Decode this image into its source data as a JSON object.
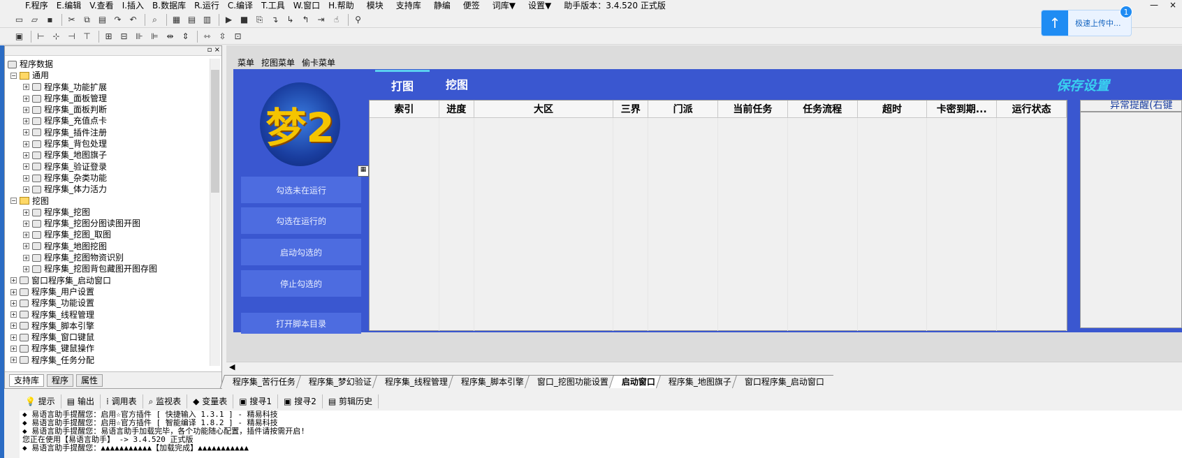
{
  "menubar": {
    "items": [
      "F.程序",
      "E.编辑",
      "V.查看",
      "I.插入",
      "B.数据库",
      "R.运行",
      "C.编译",
      "T.工具",
      "W.窗口",
      "H.帮助",
      "模块",
      "支持库",
      "静编",
      "便签",
      "词库▼",
      "设置▼",
      "助手版本：3.4.520 正式版"
    ],
    "window_min": "—",
    "window_close": "×"
  },
  "upload": {
    "label": "极速上传中...",
    "count": "1"
  },
  "left_panel": {
    "tree": [
      {
        "text": "程序数据",
        "depth": 0,
        "type": "root"
      },
      {
        "text": "通用",
        "depth": 0,
        "type": "folder",
        "expander": "−"
      },
      {
        "text": "程序集_功能扩展",
        "depth": 1,
        "type": "item",
        "expander": "+"
      },
      {
        "text": "程序集_面板管理",
        "depth": 1,
        "type": "item",
        "expander": "+"
      },
      {
        "text": "程序集_面板判断",
        "depth": 1,
        "type": "item",
        "expander": "+"
      },
      {
        "text": "程序集_充值点卡",
        "depth": 1,
        "type": "item",
        "expander": "+"
      },
      {
        "text": "程序集_插件注册",
        "depth": 1,
        "type": "item",
        "expander": "+"
      },
      {
        "text": "程序集_背包处理",
        "depth": 1,
        "type": "item",
        "expander": "+"
      },
      {
        "text": "程序集_地图旗子",
        "depth": 1,
        "type": "item",
        "expander": "+"
      },
      {
        "text": "程序集_验证登录",
        "depth": 1,
        "type": "item",
        "expander": "+"
      },
      {
        "text": "程序集_杂类功能",
        "depth": 1,
        "type": "item",
        "expander": "+"
      },
      {
        "text": "程序集_体力活力",
        "depth": 1,
        "type": "item",
        "expander": "+"
      },
      {
        "text": "挖图",
        "depth": 0,
        "type": "folder",
        "expander": "−"
      },
      {
        "text": "程序集_挖图",
        "depth": 1,
        "type": "item",
        "expander": "+"
      },
      {
        "text": "程序集_挖图分图读图开图",
        "depth": 1,
        "type": "item",
        "expander": "+"
      },
      {
        "text": "程序集_挖图_取图",
        "depth": 1,
        "type": "item",
        "expander": "+"
      },
      {
        "text": "程序集_地图挖图",
        "depth": 1,
        "type": "item",
        "expander": "+"
      },
      {
        "text": "程序集_挖图物资识别",
        "depth": 1,
        "type": "item",
        "expander": "+"
      },
      {
        "text": "程序集_挖图背包藏图开图存图",
        "depth": 1,
        "type": "item",
        "expander": "+"
      },
      {
        "text": "窗口程序集_启动窗口",
        "depth": 0,
        "type": "item",
        "expander": "+"
      },
      {
        "text": "程序集_用户设置",
        "depth": 0,
        "type": "item",
        "expander": "+"
      },
      {
        "text": "程序集_功能设置",
        "depth": 0,
        "type": "item",
        "expander": "+"
      },
      {
        "text": "程序集_线程管理",
        "depth": 0,
        "type": "item",
        "expander": "+"
      },
      {
        "text": "程序集_脚本引擎",
        "depth": 0,
        "type": "item",
        "expander": "+"
      },
      {
        "text": "程序集_窗口键鼠",
        "depth": 0,
        "type": "item",
        "expander": "+"
      },
      {
        "text": "程序集_键鼠操作",
        "depth": 0,
        "type": "item",
        "expander": "+"
      },
      {
        "text": "程序集_任务分配",
        "depth": 0,
        "type": "item",
        "expander": "+"
      }
    ],
    "tabs": [
      "支持库",
      "程序",
      "属性"
    ]
  },
  "form": {
    "top_menu": [
      "菜单",
      "挖图菜单",
      "偷卡菜单"
    ],
    "logo_text": "梦2",
    "buttons": [
      "勾选未在运行",
      "勾选在运行的",
      "启动勾选的",
      "停止勾选的",
      "打开脚本目录"
    ],
    "tabs": [
      "打图",
      "挖图"
    ],
    "save_label": "保存设置",
    "columns": [
      "索引",
      "进度",
      "大区",
      "三界",
      "门派",
      "当前任务",
      "任务流程",
      "超时",
      "卡密到期...",
      "运行状态"
    ],
    "alert_title": "异常提醒(右键"
  },
  "file_tabs": [
    "程序集_苦行任务",
    "程序集_梦幻验证",
    "程序集_线程管理",
    "程序集_脚本引擎",
    "窗口_挖图功能设置",
    "启动窗口",
    "程序集_地图旗子",
    "窗口程序集_启动窗口"
  ],
  "output_tabs": [
    "提示",
    "输出",
    "调用表",
    "监视表",
    "变量表",
    "搜寻1",
    "搜寻2",
    "剪辑历史"
  ],
  "output_lines": [
    "◆ 易语言助手提醒您：启用☆官方插件 [ 快捷输入 1.3.1 ] - 精易科技",
    "◆ 易语言助手提醒您：启用☆官方插件 [ 智能编译 1.8.2 ] - 精易科技",
    "◆ 易语言助手提醒您：易语言助手加载完毕，各个功能随心配置，插件请按需开启!",
    "您正在使用【易语言助手】 ->  3.4.520 正式版",
    "◆ 易语言助手提醒您：▲▲▲▲▲▲▲▲▲▲▲【加载完成】▲▲▲▲▲▲▲▲▲▲▲"
  ]
}
